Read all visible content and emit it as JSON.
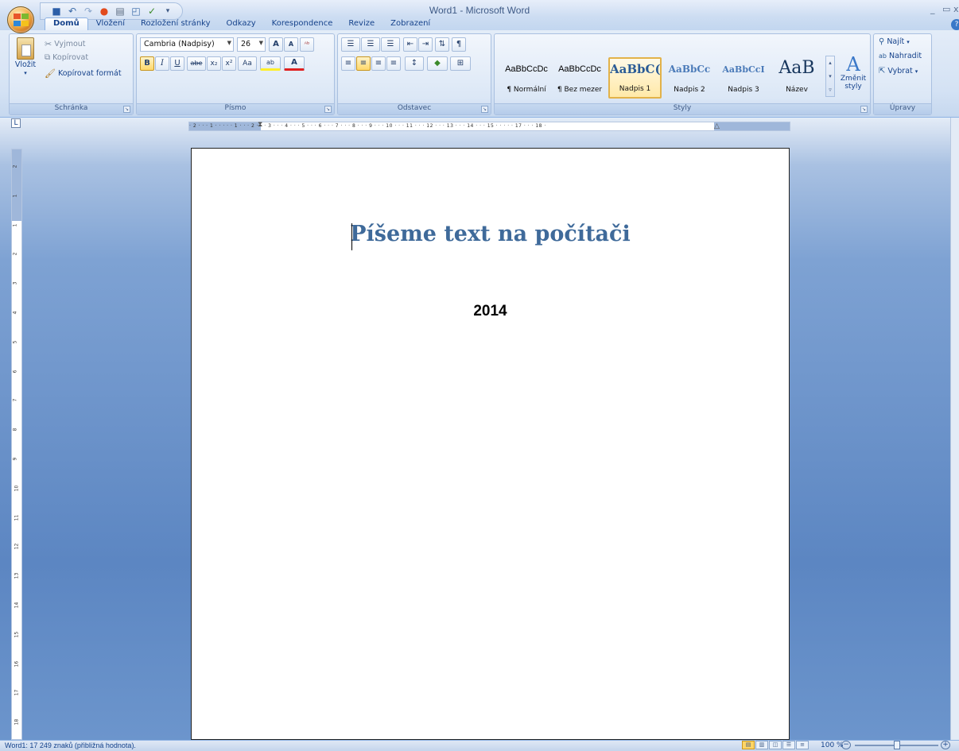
{
  "window": {
    "title": "Word1 - Microsoft Word",
    "minimize": "_",
    "maximize": "▭",
    "close": "x",
    "help": "?"
  },
  "qat": {
    "icons": [
      "save-icon",
      "undo-icon",
      "redo-icon",
      "record-icon",
      "print-icon",
      "print-preview-icon",
      "spellcheck-icon",
      "customize-qat-icon"
    ],
    "glyphs": [
      "💾",
      "↶",
      "↷",
      "●",
      "🖶",
      "🔍",
      "✓",
      "▾"
    ]
  },
  "tabs": [
    "Domů",
    "Vložení",
    "Rozložení stránky",
    "Odkazy",
    "Korespondence",
    "Revize",
    "Zobrazení"
  ],
  "active_tab": "Domů",
  "clipboard": {
    "paste": "Vložit",
    "cut": "Vyjmout",
    "copy": "Kopírovat",
    "format_painter": "Kopírovat formát",
    "label": "Schránka"
  },
  "font": {
    "name": "Cambria (Nadpisy)",
    "size": "26",
    "grow": "A",
    "shrink": "A",
    "clear": "ᴬᵇ",
    "bold": "B",
    "italic": "I",
    "underline": "U",
    "strike": "abe",
    "subscript": "x₂",
    "superscript": "x²",
    "case": "Aa",
    "highlight": "ab",
    "color": "A",
    "label": "Písmo"
  },
  "paragraph": {
    "bullets": "☰",
    "numbering": "☰",
    "multilevel": "☰",
    "decrease_indent": "⇤",
    "increase_indent": "⇥",
    "sort": "⇅",
    "show_marks": "¶",
    "align_left": "≡",
    "align_center": "≡",
    "align_right": "≡",
    "justify": "≡",
    "line_spacing": "↕",
    "shading": "◆",
    "borders": "⊞",
    "label": "Odstavec"
  },
  "styles": {
    "items": [
      {
        "sample": "AaBbCcDc",
        "name": "¶ Normální"
      },
      {
        "sample": "AaBbCcDc",
        "name": "¶ Bez mezer"
      },
      {
        "sample": "AaBbC(",
        "name": "Nadpis 1"
      },
      {
        "sample": "AaBbCc",
        "name": "Nadpis 2"
      },
      {
        "sample": "AaBbCcI",
        "name": "Nadpis 3"
      },
      {
        "sample": "AaB",
        "name": "Název"
      }
    ],
    "change_styles": "Změnit styly",
    "label": "Styly"
  },
  "editing": {
    "find": "Najít",
    "replace": "Nahradit",
    "select": "Vybrat",
    "label": "Úpravy"
  },
  "ruler": {
    "corner": "L",
    "horizontal_ticks": "· 2 · · · 1 · · · · · 1 · · · 2 · · · 3 · · · 4 · · · 5 · · · 6 · · · 7 · · · 8 · · · 9 · · · 10 · · · 11 · · · 12 · · · 13 · · · 14 · · · 15 · · · · · 17 · · · 18 ·",
    "vertical_ticks": [
      "2",
      "1",
      "1",
      "2",
      "3",
      "4",
      "5",
      "6",
      "7",
      "8",
      "9",
      "10",
      "11",
      "12",
      "13",
      "14",
      "15",
      "16",
      "17",
      "18"
    ]
  },
  "document": {
    "title": "Píšeme text na počítači",
    "year": "2014"
  },
  "status": {
    "word_count": "Word1: 17 249 znaků (přibližná hodnota).",
    "zoom": "100 %",
    "zoom_minus": "−",
    "zoom_plus": "+",
    "zoom_fraction": 0.5
  },
  "colors": {
    "heading": "#3f6a9a",
    "ribbon": "#dbe7f6",
    "accent": "#15428b"
  }
}
